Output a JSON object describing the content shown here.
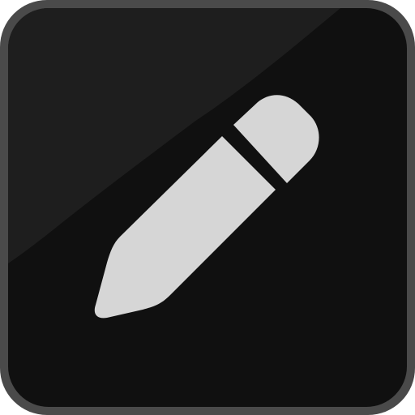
{
  "icon": {
    "name": "edit-pencil",
    "colors": {
      "border": "#4a4a4a",
      "background": "#101010",
      "highlight": "#1e1e1e",
      "pencil": "#d6d6d6"
    }
  }
}
